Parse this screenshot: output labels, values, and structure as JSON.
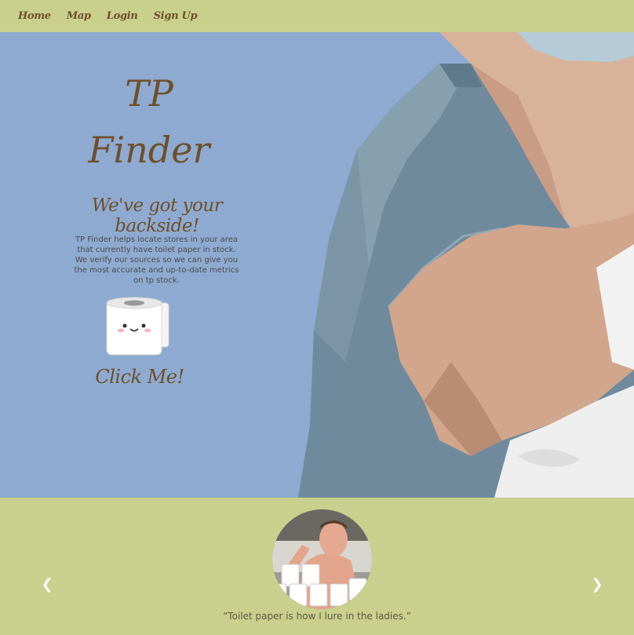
{
  "nav": {
    "items": [
      {
        "label": "Home"
      },
      {
        "label": "Map"
      },
      {
        "label": "Login"
      },
      {
        "label": "Sign Up"
      }
    ]
  },
  "hero": {
    "title_line1": "TP",
    "title_line2": "Finder",
    "tagline": "We've got your backside!",
    "description": "TP Finder helps locate stores in your area that currently have toilet paper in stock. We verify our sources so we can give you the most accurate and up-to-date metrics on tp stock.",
    "cta_label": "Click Me!",
    "cta_icon": "toilet-paper-roll-icon"
  },
  "testimonial": {
    "quote": "“Toilet paper is how I lure in the ladies.”",
    "prev_icon": "chevron-left-icon",
    "next_icon": "chevron-right-icon"
  },
  "colors": {
    "nav_bg": "#c9cf8c",
    "hero_bg": "#8eaad0",
    "brand_brown": "#6e4f2b"
  }
}
